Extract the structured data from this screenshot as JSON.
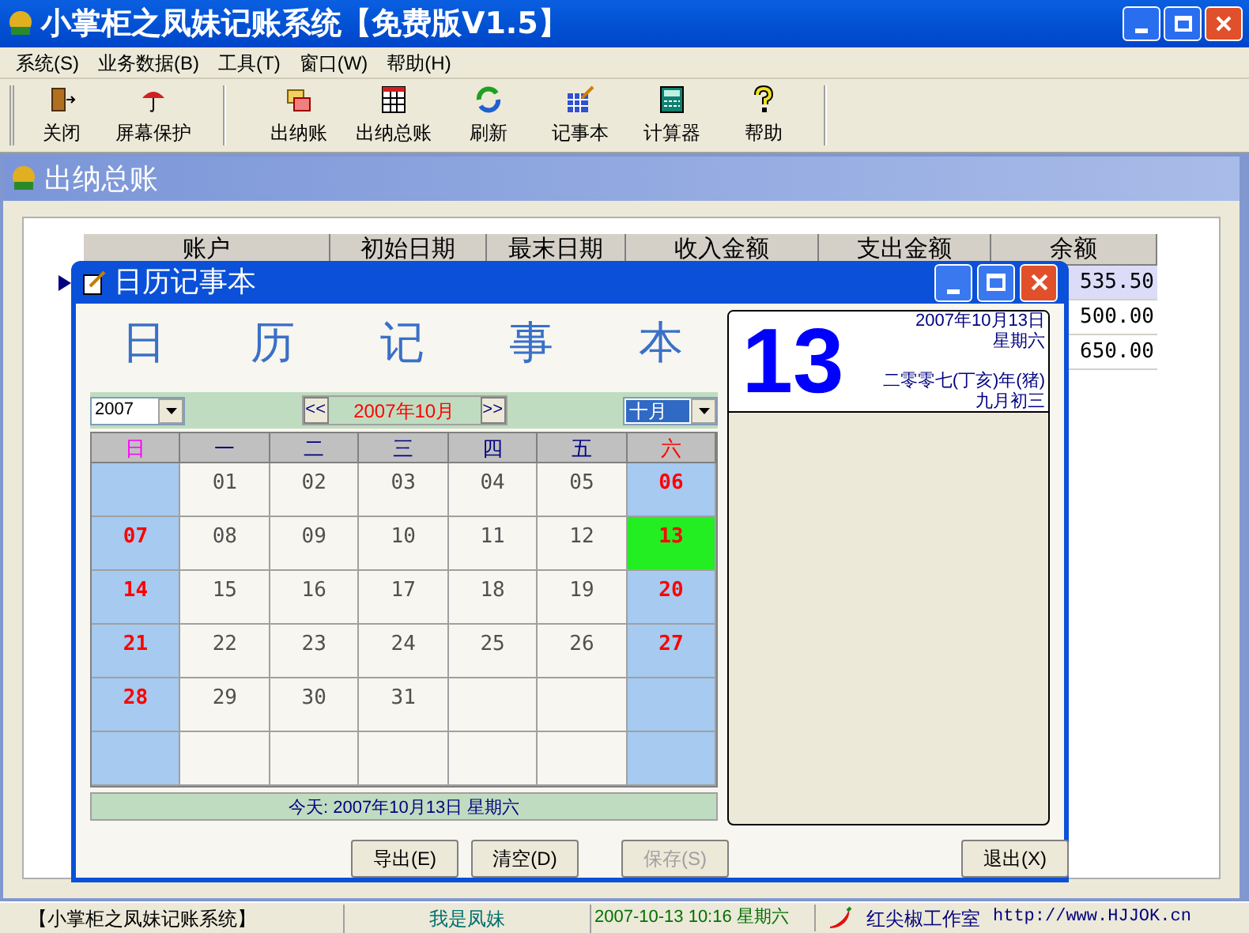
{
  "window": {
    "title": "小掌柜之凤妹记账系统【免费版V1.5】"
  },
  "menu": [
    {
      "label": "系统(S)"
    },
    {
      "label": "业务数据(B)"
    },
    {
      "label": "工具(T)"
    },
    {
      "label": "窗口(W)"
    },
    {
      "label": "帮助(H)"
    }
  ],
  "toolbar": [
    {
      "kind": "exit",
      "label": "关闭"
    },
    {
      "kind": "umbrella",
      "label": "屏幕保护"
    },
    {
      "kind": "ledger",
      "label": "出纳账"
    },
    {
      "kind": "grid",
      "label": "出纳总账"
    },
    {
      "kind": "refresh",
      "label": "刷新"
    },
    {
      "kind": "notepad",
      "label": "记事本"
    },
    {
      "kind": "calculator",
      "label": "计算器"
    },
    {
      "kind": "help",
      "label": "帮助"
    }
  ],
  "child_window": {
    "title": "出纳总账",
    "table": {
      "columns": [
        "账户",
        "初始日期",
        "最末日期",
        "收入金额",
        "支出金额",
        "余额"
      ],
      "rows": [
        {
          "balance": "535.50",
          "selected": true
        },
        {
          "balance": "500.00",
          "selected": false
        },
        {
          "balance": "650.00",
          "selected": false
        }
      ]
    }
  },
  "dialog": {
    "title": "日历记事本",
    "heading": "日 历 记 事 本",
    "year": "2007",
    "month_label": "2007年10月",
    "prev": "<<",
    "next": ">>",
    "month": "十月",
    "weekdays": [
      "日",
      "一",
      "二",
      "三",
      "四",
      "五",
      "六"
    ],
    "weeks": [
      [
        {
          "selected": false
        },
        {
          "text": "01",
          "selected": false
        },
        {
          "text": "02",
          "selected": false
        },
        {
          "text": "03",
          "selected": false
        },
        {
          "text": "04",
          "selected": false
        },
        {
          "text": "05",
          "selected": false
        },
        {
          "text": "06",
          "selected": false
        }
      ],
      [
        {
          "text": "07",
          "selected": false
        },
        {
          "text": "08",
          "selected": false
        },
        {
          "text": "09",
          "selected": false
        },
        {
          "text": "10",
          "selected": false
        },
        {
          "text": "11",
          "selected": false
        },
        {
          "text": "12",
          "selected": false
        },
        {
          "text": "13",
          "selected": true
        }
      ],
      [
        {
          "text": "14",
          "selected": false
        },
        {
          "text": "15",
          "selected": false
        },
        {
          "text": "16",
          "selected": false
        },
        {
          "text": "17",
          "selected": false
        },
        {
          "text": "18",
          "selected": false
        },
        {
          "text": "19",
          "selected": false
        },
        {
          "text": "20",
          "selected": false
        }
      ],
      [
        {
          "text": "21",
          "selected": false
        },
        {
          "text": "22",
          "selected": false
        },
        {
          "text": "23",
          "selected": false
        },
        {
          "text": "24",
          "selected": false
        },
        {
          "text": "25",
          "selected": false
        },
        {
          "text": "26",
          "selected": false
        },
        {
          "text": "27",
          "selected": false
        }
      ],
      [
        {
          "text": "28",
          "selected": false
        },
        {
          "text": "29",
          "selected": false
        },
        {
          "text": "30",
          "selected": false
        },
        {
          "text": "31",
          "selected": false
        },
        {
          "selected": false
        },
        {
          "selected": false
        },
        {
          "selected": false
        }
      ],
      [
        {
          "selected": false
        },
        {
          "selected": false
        },
        {
          "selected": false
        },
        {
          "selected": false
        },
        {
          "selected": false
        },
        {
          "selected": false
        },
        {
          "selected": false
        }
      ]
    ],
    "today": "今天: 2007年10月13日 星期六",
    "big_day": "13",
    "date": "2007年10月13日",
    "weekday": "星期六",
    "lunar_year": "二零零七(丁亥)年(猪)",
    "lunar_day": "九月初三",
    "buttons": [
      {
        "label": "导出(E)",
        "disabled": false
      },
      {
        "label": "清空(D)",
        "disabled": false
      },
      {
        "label": "保存(S)",
        "disabled": true
      },
      {
        "label": "退出(X)",
        "disabled": false
      }
    ]
  },
  "status_bar": {
    "app": "【小掌柜之凤妹记账系统】",
    "user": "我是凤妹",
    "datetime": "2007-10-13 10:16 星期六",
    "studio": "红尖椒工作室",
    "url": "http://www.HJJOK.cn"
  }
}
